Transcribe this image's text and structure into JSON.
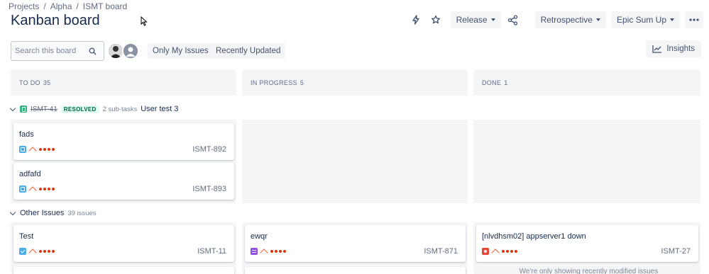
{
  "breadcrumb": [
    "Projects",
    "Alpha",
    "ISMT board"
  ],
  "page_title": "Kanban board",
  "header_buttons": {
    "release": "Release",
    "retrospective": "Retrospective",
    "epic_sum_up": "Epic Sum Up",
    "insights": "Insights"
  },
  "search": {
    "placeholder": "Search this board",
    "value": ""
  },
  "quick_filters": [
    "Only My Issues",
    "Recently Updated"
  ],
  "columns": [
    {
      "title": "TO DO",
      "count": "35"
    },
    {
      "title": "IN PROGRESS",
      "count": "5"
    },
    {
      "title": "DONE",
      "count": "1"
    }
  ],
  "swimlane_parent": {
    "key": "ISMT-41",
    "status": "RESOLVED",
    "subtasks": "2 sub-tasks",
    "summary": "User test 3"
  },
  "parent_cards": [
    {
      "summary": "fads",
      "key": "ISMT-892",
      "type": "subtask"
    },
    {
      "summary": "adfafd",
      "key": "ISMT-893",
      "type": "subtask"
    }
  ],
  "swimlane_other": {
    "title": "Other Issues",
    "count": "39 issues"
  },
  "other_cards": [
    {
      "summary": "Test",
      "key": "ISMT-11",
      "type": "task"
    },
    {
      "summary": "ewqr",
      "key": "ISMT-871",
      "type": "epic"
    },
    {
      "summary": "[nlvdhsm02] appserver1 down",
      "key": "ISMT-27",
      "type": "bug"
    }
  ],
  "done_notice": "We're only showing recently modified issues",
  "colors": {
    "accent": "#0052cc",
    "priority": "#de350b",
    "column_bg": "#f4f5f7"
  }
}
